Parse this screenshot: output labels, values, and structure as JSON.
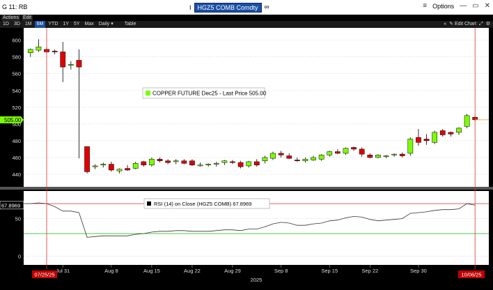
{
  "window": {
    "title_left": "G 11: RB",
    "ticker": "HGZ5 COMB Comdty",
    "options_label": "Options"
  },
  "menus": [
    "Actions",
    "Edit"
  ],
  "periods": [
    "1D",
    "3D",
    "1M",
    "6M",
    "YTD",
    "1Y",
    "5Y",
    "Max"
  ],
  "active_period": "6M",
  "frequency": "Daily",
  "table_label": "Table",
  "edit_chart_label": "Edit Chart",
  "colors": {
    "up": "#7cfc00",
    "down": "#e00000",
    "price_tag": "#7cfc00",
    "overbought": "#e03030",
    "oversold": "#2ec02e",
    "crosshair": "#e03030",
    "ticker_bg": "#1a4fa3"
  },
  "chart_data": [
    {
      "type": "candlestick",
      "legend": "COPPER FUTURE Dec25 - Last Price 505.00",
      "last_price_label": "505.00",
      "y_ticks": [
        600,
        580,
        560,
        540,
        520,
        500,
        480,
        460,
        440
      ],
      "ylim": [
        430,
        608
      ],
      "candles": [
        {
          "o": 585,
          "h": 590,
          "l": 580,
          "c": 589
        },
        {
          "o": 588,
          "h": 601,
          "l": 586,
          "c": 592
        },
        {
          "o": 589,
          "h": 592,
          "l": 584,
          "c": 586
        },
        {
          "o": 587,
          "h": 589,
          "l": 583,
          "c": 586
        },
        {
          "o": 586,
          "h": 598,
          "l": 550,
          "c": 568
        },
        {
          "o": 570,
          "h": 575,
          "l": 565,
          "c": 571
        },
        {
          "o": 576,
          "h": 589,
          "l": 459,
          "c": 568
        },
        {
          "o": 473,
          "h": 473,
          "l": 441,
          "c": 443
        },
        {
          "o": 449,
          "h": 452,
          "l": 446,
          "c": 450
        },
        {
          "o": 451,
          "h": 454,
          "l": 448,
          "c": 452
        },
        {
          "o": 452,
          "h": 455,
          "l": 443,
          "c": 445
        },
        {
          "o": 444,
          "h": 447,
          "l": 441,
          "c": 446
        },
        {
          "o": 447,
          "h": 451,
          "l": 444,
          "c": 445
        },
        {
          "o": 447,
          "h": 455,
          "l": 446,
          "c": 453
        },
        {
          "o": 455,
          "h": 456,
          "l": 449,
          "c": 451
        },
        {
          "o": 451,
          "h": 460,
          "l": 449,
          "c": 458
        },
        {
          "o": 458,
          "h": 460,
          "l": 454,
          "c": 456
        },
        {
          "o": 456,
          "h": 458,
          "l": 452,
          "c": 454
        },
        {
          "o": 455,
          "h": 458,
          "l": 452,
          "c": 456
        },
        {
          "o": 456,
          "h": 458,
          "l": 452,
          "c": 453
        },
        {
          "o": 456,
          "h": 458,
          "l": 450,
          "c": 451
        },
        {
          "o": 451,
          "h": 454,
          "l": 449,
          "c": 451
        },
        {
          "o": 451,
          "h": 453,
          "l": 449,
          "c": 452
        },
        {
          "o": 452,
          "h": 455,
          "l": 449,
          "c": 453
        },
        {
          "o": 454,
          "h": 457,
          "l": 451,
          "c": 456
        },
        {
          "o": 455,
          "h": 457,
          "l": 452,
          "c": 454
        },
        {
          "o": 454,
          "h": 456,
          "l": 447,
          "c": 449
        },
        {
          "o": 450,
          "h": 456,
          "l": 448,
          "c": 455
        },
        {
          "o": 455,
          "h": 458,
          "l": 449,
          "c": 451
        },
        {
          "o": 456,
          "h": 462,
          "l": 453,
          "c": 460
        },
        {
          "o": 459,
          "h": 467,
          "l": 457,
          "c": 465
        },
        {
          "o": 465,
          "h": 468,
          "l": 460,
          "c": 463
        },
        {
          "o": 462,
          "h": 465,
          "l": 458,
          "c": 459
        },
        {
          "o": 457,
          "h": 460,
          "l": 455,
          "c": 456
        },
        {
          "o": 456,
          "h": 460,
          "l": 454,
          "c": 458
        },
        {
          "o": 457,
          "h": 462,
          "l": 456,
          "c": 460
        },
        {
          "o": 458,
          "h": 464,
          "l": 456,
          "c": 463
        },
        {
          "o": 463,
          "h": 468,
          "l": 461,
          "c": 467
        },
        {
          "o": 467,
          "h": 470,
          "l": 464,
          "c": 465
        },
        {
          "o": 465,
          "h": 472,
          "l": 463,
          "c": 471
        },
        {
          "o": 472,
          "h": 473,
          "l": 468,
          "c": 470
        },
        {
          "o": 470,
          "h": 472,
          "l": 461,
          "c": 464
        },
        {
          "o": 463,
          "h": 465,
          "l": 459,
          "c": 460
        },
        {
          "o": 460,
          "h": 464,
          "l": 459,
          "c": 463
        },
        {
          "o": 461,
          "h": 463,
          "l": 459,
          "c": 462
        },
        {
          "o": 463,
          "h": 465,
          "l": 461,
          "c": 464
        },
        {
          "o": 464,
          "h": 466,
          "l": 460,
          "c": 462
        },
        {
          "o": 465,
          "h": 484,
          "l": 462,
          "c": 482
        },
        {
          "o": 484,
          "h": 494,
          "l": 474,
          "c": 478
        },
        {
          "o": 482,
          "h": 488,
          "l": 475,
          "c": 480
        },
        {
          "o": 478,
          "h": 492,
          "l": 476,
          "c": 490
        },
        {
          "o": 492,
          "h": 494,
          "l": 485,
          "c": 487
        },
        {
          "o": 490,
          "h": 491,
          "l": 485,
          "c": 488
        },
        {
          "o": 490,
          "h": 496,
          "l": 487,
          "c": 495
        },
        {
          "o": 497,
          "h": 512,
          "l": 495,
          "c": 510
        },
        {
          "o": 508,
          "h": 510,
          "l": 503,
          "c": 505
        }
      ]
    },
    {
      "type": "line",
      "legend": "RSI (14)  on Close (HGZ5 COMB) 67.8969",
      "last_value_label": "67.8969",
      "y_ticks": [
        50,
        0
      ],
      "ylim": [
        -10,
        85
      ],
      "overbought": 70,
      "oversold": 30,
      "values": [
        70,
        71,
        70,
        66,
        60,
        60,
        58,
        25,
        26,
        27,
        27,
        27,
        27,
        29,
        30,
        32,
        33,
        33,
        34,
        34,
        33,
        33,
        33,
        34,
        35,
        35,
        34,
        36,
        36,
        39,
        43,
        45,
        44,
        41,
        41,
        43,
        44,
        47,
        48,
        51,
        53,
        52,
        49,
        47,
        48,
        49,
        50,
        57,
        58,
        59,
        61,
        62,
        62,
        63,
        70,
        67.9
      ],
      "x_ticks": [
        "Jul 31",
        "Aug 8",
        "Aug 15",
        "Aug 22",
        "Aug 29",
        "Sep 8",
        "Sep 15",
        "Sep 22",
        "Sep 30"
      ],
      "x_year": "2025",
      "start_date": "07/25/25",
      "end_date": "10/06/25"
    }
  ]
}
